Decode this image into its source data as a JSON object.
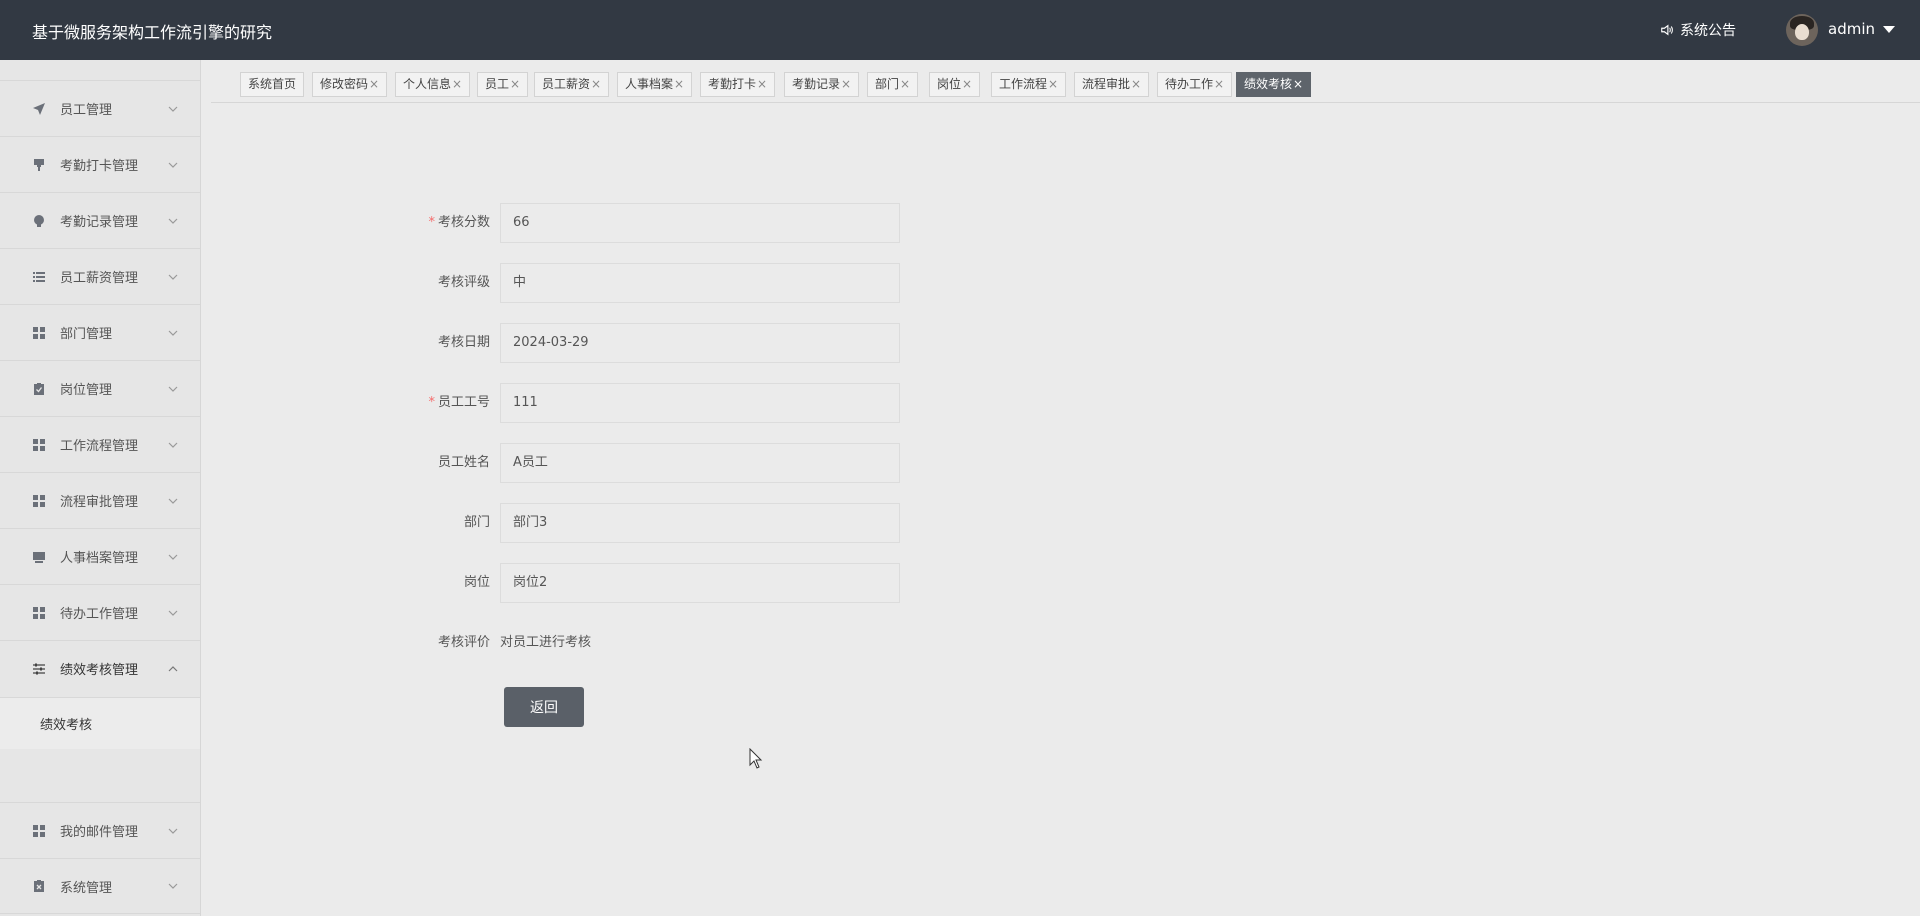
{
  "header": {
    "title": "基于微服务架构工作流引擎的研究",
    "notice_label": "系统公告",
    "username": "admin"
  },
  "sidebar": {
    "items": [
      {
        "label": "员工管理",
        "icon": "send-icon"
      },
      {
        "label": "考勤打卡管理",
        "icon": "brush-icon"
      },
      {
        "label": "考勤记录管理",
        "icon": "bulb-icon"
      },
      {
        "label": "员工薪资管理",
        "icon": "list-icon"
      },
      {
        "label": "部门管理",
        "icon": "grid-icon"
      },
      {
        "label": "岗位管理",
        "icon": "clipboard-check-icon"
      },
      {
        "label": "工作流程管理",
        "icon": "grid-icon"
      },
      {
        "label": "流程审批管理",
        "icon": "grid-icon"
      },
      {
        "label": "人事档案管理",
        "icon": "monitor-icon"
      },
      {
        "label": "待办工作管理",
        "icon": "grid-icon"
      },
      {
        "label": "绩效考核管理",
        "icon": "sliders-icon",
        "open": true
      },
      {
        "label": "我的邮件管理",
        "icon": "grid-icon"
      },
      {
        "label": "系统管理",
        "icon": "clipboard-x-icon"
      }
    ],
    "sub_item": "绩效考核"
  },
  "tabs": [
    {
      "label": "系统首页",
      "closable": false
    },
    {
      "label": "修改密码",
      "closable": true
    },
    {
      "label": "个人信息",
      "closable": true
    },
    {
      "label": "员工",
      "closable": true
    },
    {
      "label": "员工薪资",
      "closable": true
    },
    {
      "label": "人事档案",
      "closable": true
    },
    {
      "label": "考勤打卡",
      "closable": true
    },
    {
      "label": "考勤记录",
      "closable": true
    },
    {
      "label": "部门",
      "closable": true
    },
    {
      "label": "岗位",
      "closable": true
    },
    {
      "label": "工作流程",
      "closable": true
    },
    {
      "label": "流程审批",
      "closable": true
    },
    {
      "label": "待办工作",
      "closable": true
    },
    {
      "label": "绩效考核",
      "closable": true,
      "active": true
    }
  ],
  "form": {
    "score": {
      "label": "考核分数",
      "value": "66",
      "required": true
    },
    "grade": {
      "label": "考核评级",
      "value": "中"
    },
    "date": {
      "label": "考核日期",
      "value": "2024-03-29"
    },
    "emp_no": {
      "label": "员工工号",
      "value": "111",
      "required": true
    },
    "emp_name": {
      "label": "员工姓名",
      "value": "A员工"
    },
    "dept": {
      "label": "部门",
      "value": "部门3"
    },
    "post": {
      "label": "岗位",
      "value": "岗位2"
    },
    "comment": {
      "label": "考核评价",
      "value": "对员工进行考核"
    }
  },
  "buttons": {
    "back": "返回"
  },
  "colors": {
    "header_bg": "#323943",
    "active_tab": "#5e646b",
    "required": "#f56c6c",
    "button": "#5a6068"
  }
}
